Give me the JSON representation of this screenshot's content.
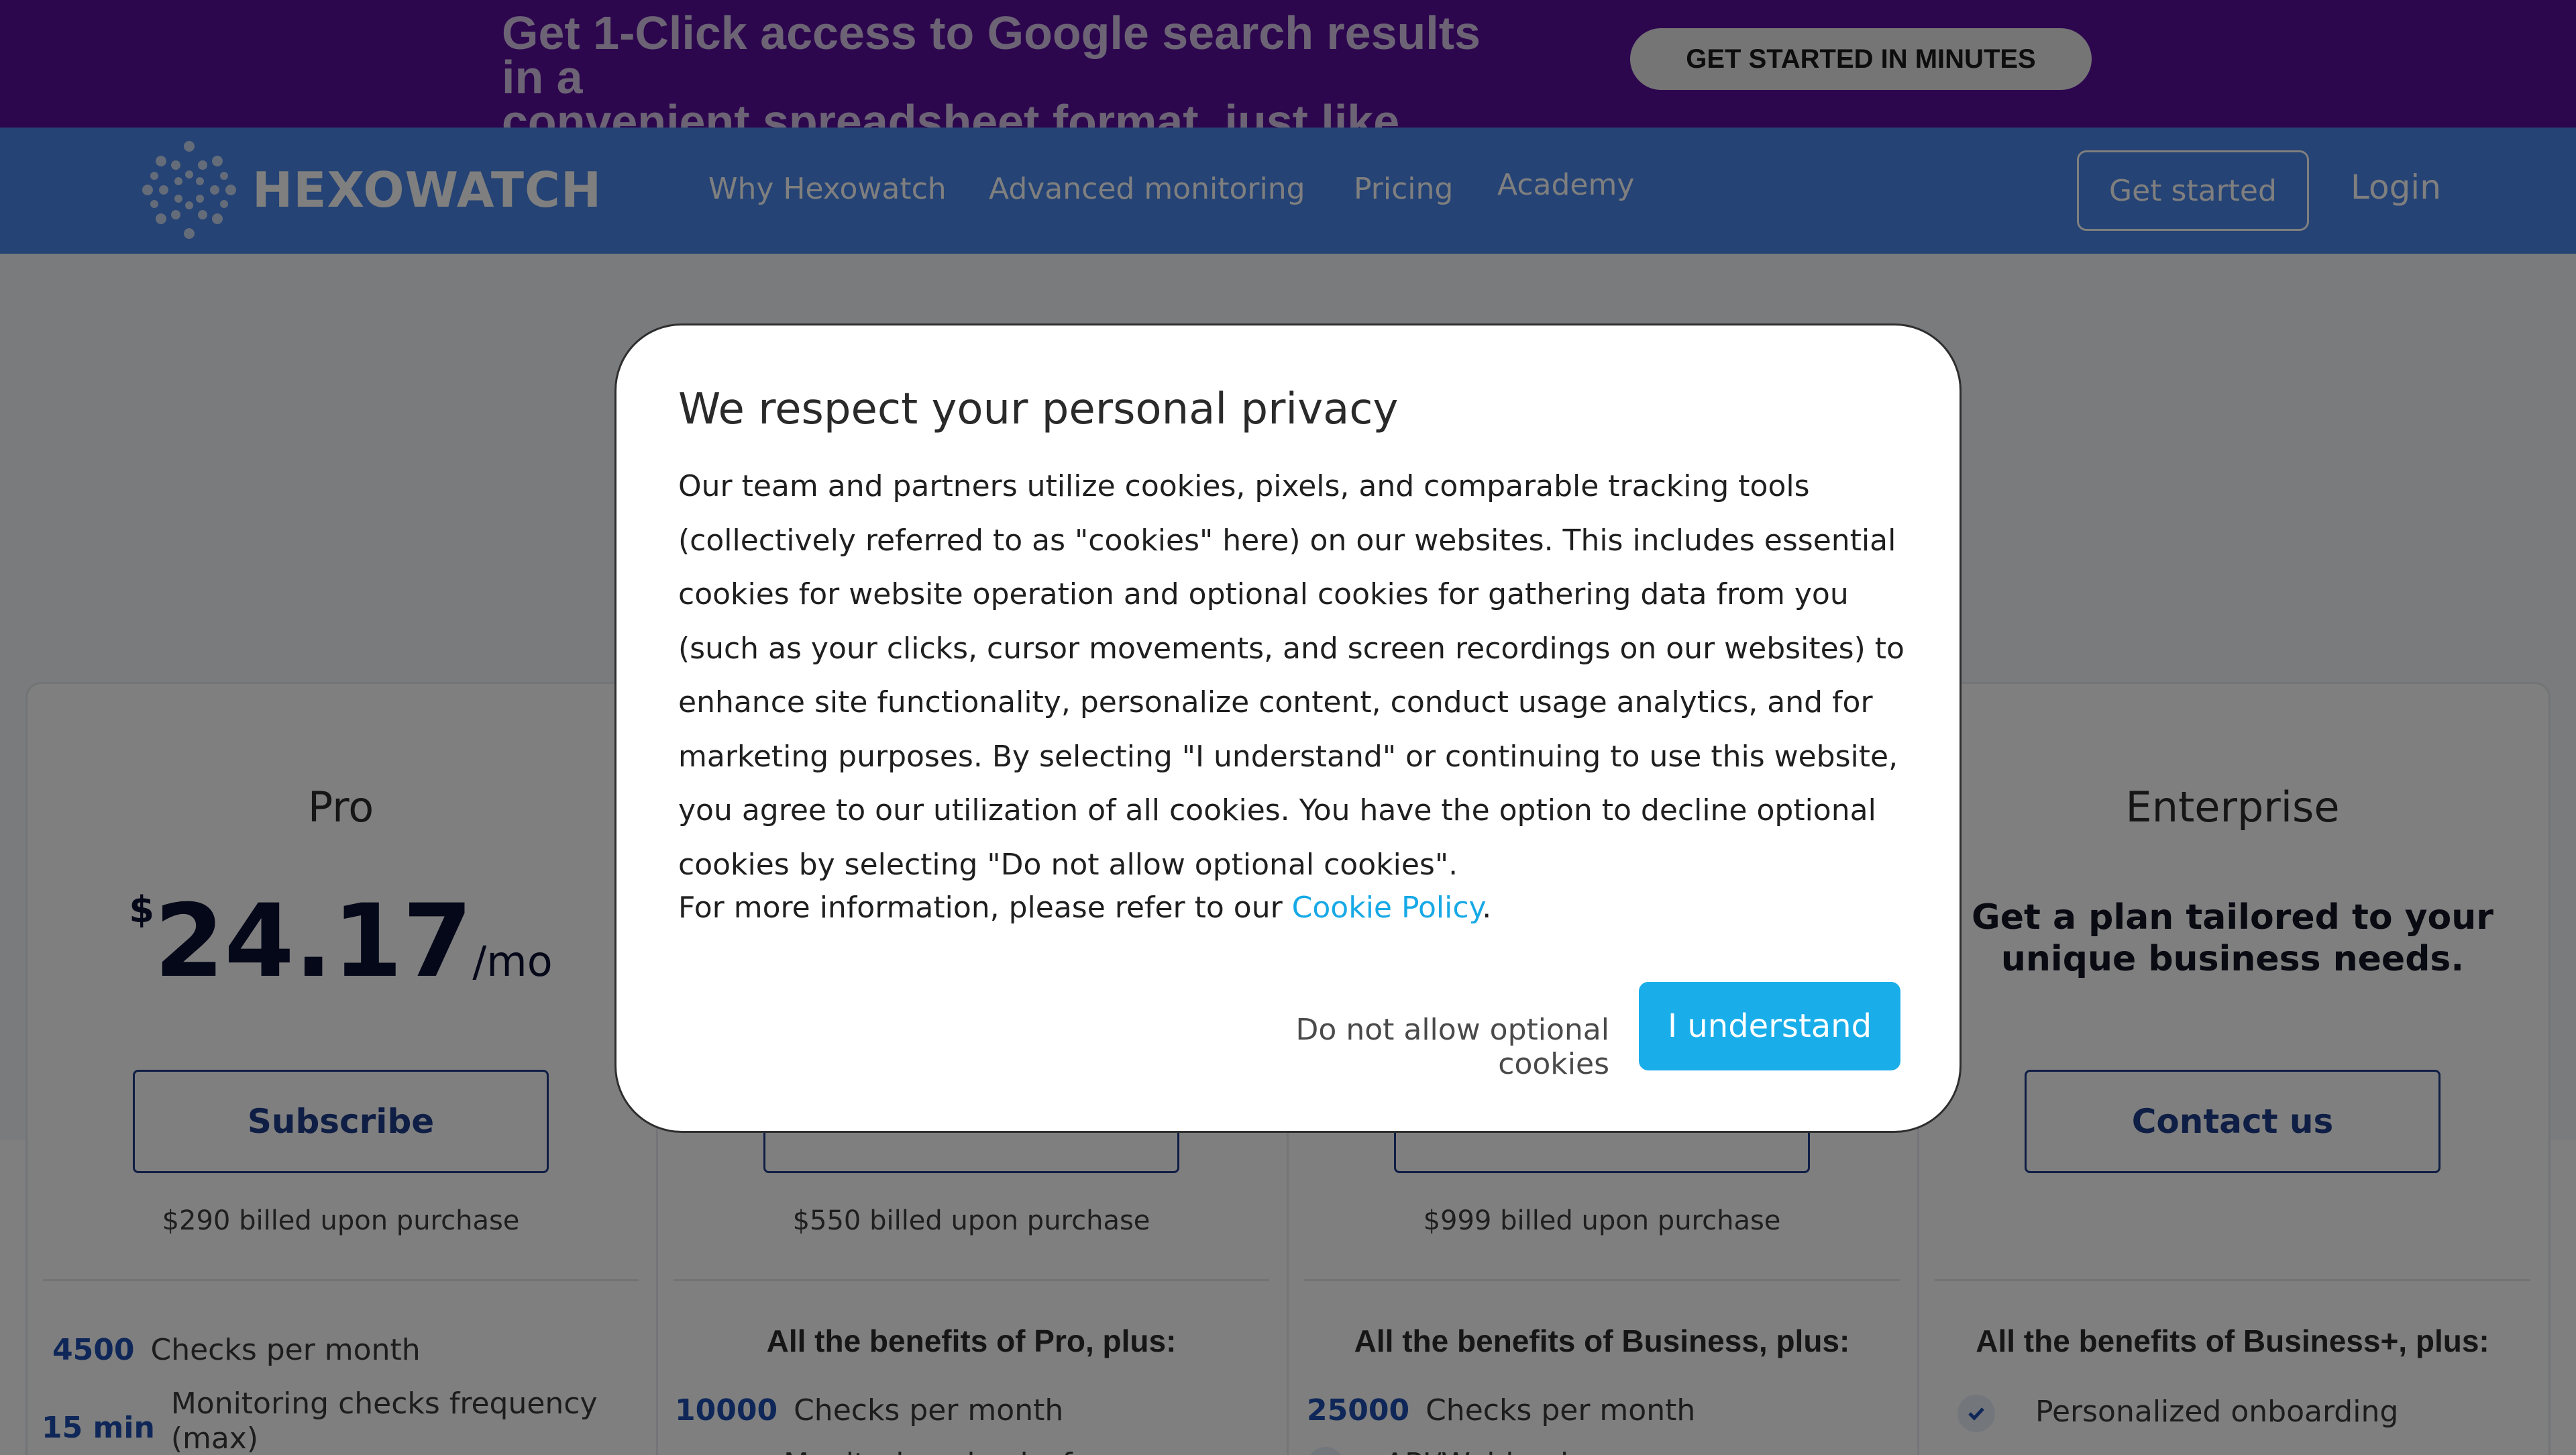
{
  "promo": {
    "text_line1": "Get 1-Click access to Google search results in a",
    "text_line2": "convenient spreadsheet format, just like magic.",
    "cta_label": "GET STARTED IN MINUTES"
  },
  "nav": {
    "brand": "HEXOWATCH",
    "links": [
      "Why Hexowatch",
      "Advanced monitoring",
      "Pricing",
      "Academy"
    ],
    "get_started_label": "Get started",
    "login_label": "Login"
  },
  "plans": [
    {
      "name": "Pro",
      "currency": "$",
      "price": "24.17",
      "period": "/mo",
      "button_label": "Subscribe",
      "billing": "$290 billed upon purchase",
      "features": [
        {
          "value": "4500",
          "label": "Checks per month"
        },
        {
          "value": "15 min",
          "label": "Monitoring checks frequency (max)"
        }
      ]
    },
    {
      "billing": "$550 billed upon purchase",
      "benefits_head": "All the benefits of Pro, plus:",
      "features": [
        {
          "value": "10000",
          "label": "Checks per month"
        },
        {
          "value": "",
          "label": "Monitoring checks frequency"
        }
      ]
    },
    {
      "billing": "$999 billed upon purchase",
      "benefits_head": "All the benefits of Business, plus:",
      "features": [
        {
          "value": "25000",
          "label": "Checks per month"
        },
        {
          "value": "",
          "label": "API/Webhook"
        }
      ]
    },
    {
      "name": "Enterprise",
      "tagline": "Get a plan tailored to your unique business needs.",
      "button_label": "Contact us",
      "benefits_head": "All the benefits of Business+, plus:",
      "features": [
        {
          "label": "Personalized onboarding"
        }
      ]
    }
  ],
  "modal": {
    "title": "We respect your personal privacy",
    "body": "Our team and partners utilize cookies, pixels, and comparable tracking tools (collectively referred to as \"cookies\" here) on our websites. This includes essential cookies for website operation and optional cookies for gathering data from you (such as your clicks, cursor movements, and screen recordings on our websites) to enhance site functionality, personalize content, conduct usage analytics, and for marketing purposes. By selecting \"I understand\" or continuing to use this website, you agree to our utilization of all cookies. You have the option to decline optional cookies by selecting \"Do not allow optional cookies\".",
    "more_prefix": "For more information, please refer to our ",
    "link_label": "Cookie Policy",
    "more_suffix": ".",
    "decline_label": "Do not allow optional cookies",
    "accept_label": "I understand"
  },
  "colors": {
    "promo_bg": "#5b0f9c",
    "nav_bg": "#4a86e8",
    "accent": "#19aeea",
    "plan_button": "#1e3d8a"
  },
  "icons": [
    "hexowatch-logo-icon",
    "check-icon"
  ]
}
